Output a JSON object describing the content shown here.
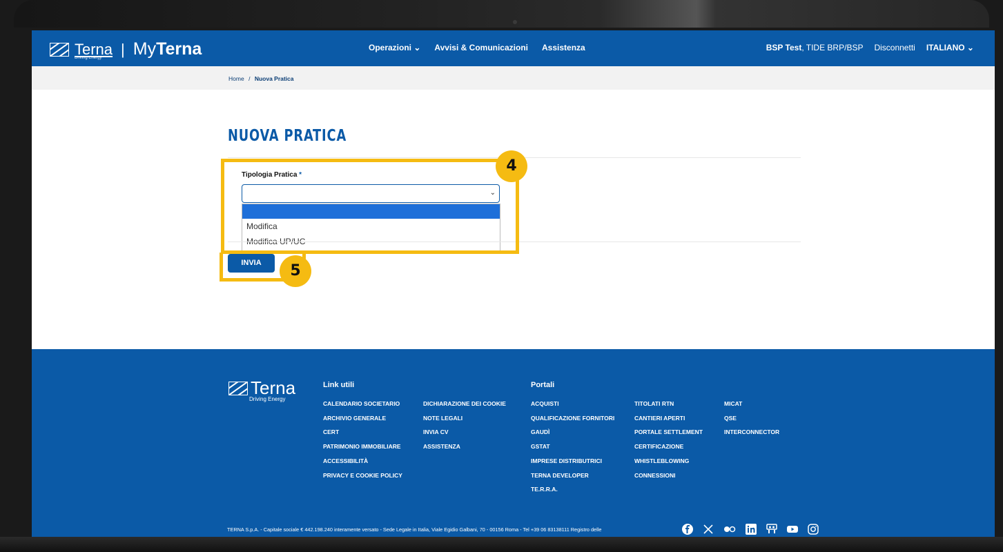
{
  "header": {
    "logo_word": "Terna",
    "logo_sub": "Driving Energy",
    "logo_sep": "|",
    "brand_prefix": "My",
    "brand_bold": "Terna",
    "nav": [
      {
        "label": "Operazioni ⌄"
      },
      {
        "label": "Avvisi & Comunicazioni"
      },
      {
        "label": "Assistenza"
      }
    ],
    "user_bold": "BSP Test",
    "user_rest": ", TIDE BRP/BSP",
    "logout": "Disconnetti",
    "language": "ITALIANO ⌄"
  },
  "breadcrumb": {
    "home": "Home",
    "sep": "/",
    "current": "Nuova Pratica"
  },
  "page": {
    "title": "NUOVA PRATICA"
  },
  "form": {
    "field_label": "Tipologia Pratica",
    "required_mark": "*",
    "select_value": "",
    "chevron": "⌄",
    "options": [
      "",
      "Modifica",
      "Modifica UP/UC"
    ],
    "submit_label": "INVIA"
  },
  "annotations": {
    "step_a": "4",
    "step_b": "5",
    "color": "#f5bb12"
  },
  "footer": {
    "logo_word": "Terna",
    "logo_sub": "Driving Energy",
    "useful_links_title": "Link utili",
    "useful_links_col1": [
      "CALENDARIO SOCIETARIO",
      "ARCHIVIO GENERALE",
      "CERT",
      "PATRIMONIO IMMOBILIARE",
      "ACCESSIBILITÀ",
      "PRIVACY E COOKIE POLICY"
    ],
    "useful_links_col2": [
      "DICHIARAZIONE DEI COOKIE",
      "NOTE LEGALI",
      "INVIA CV",
      "ASSISTENZA"
    ],
    "portals_title": "Portali",
    "portals_col1": [
      "ACQUISTI",
      "QUALIFICAZIONE FORNITORI",
      "GAUDÌ",
      "GSTAT",
      "IMPRESE DISTRIBUTRICI",
      "TERNA DEVELOPER",
      "TE.R.R.A."
    ],
    "portals_col2": [
      "TITOLATI RTN",
      "CANTIERI APERTI",
      "PORTALE SETTLEMENT",
      "CERTIFICAZIONE",
      "WHISTLEBLOWING",
      "CONNESSIONI"
    ],
    "portals_col3": [
      "MICAT",
      "QSE",
      "INTERCONNECTOR"
    ],
    "legal": "TERNA S.p.A. - Capitale sociale € 442.198.240 interamente versato - Sede Legale in Italia, Viale Egidio Galbani, 70 - 00156 Roma - Tel +39 06 83138111 Registro delle",
    "social": [
      "facebook-icon",
      "x-icon",
      "flickr-icon",
      "linkedin-icon",
      "slideshare-icon",
      "youtube-icon",
      "instagram-icon"
    ]
  },
  "colors": {
    "brand_blue": "#0b5aa7",
    "highlight": "#f5bb12",
    "selected_option": "#1e6fd9"
  }
}
